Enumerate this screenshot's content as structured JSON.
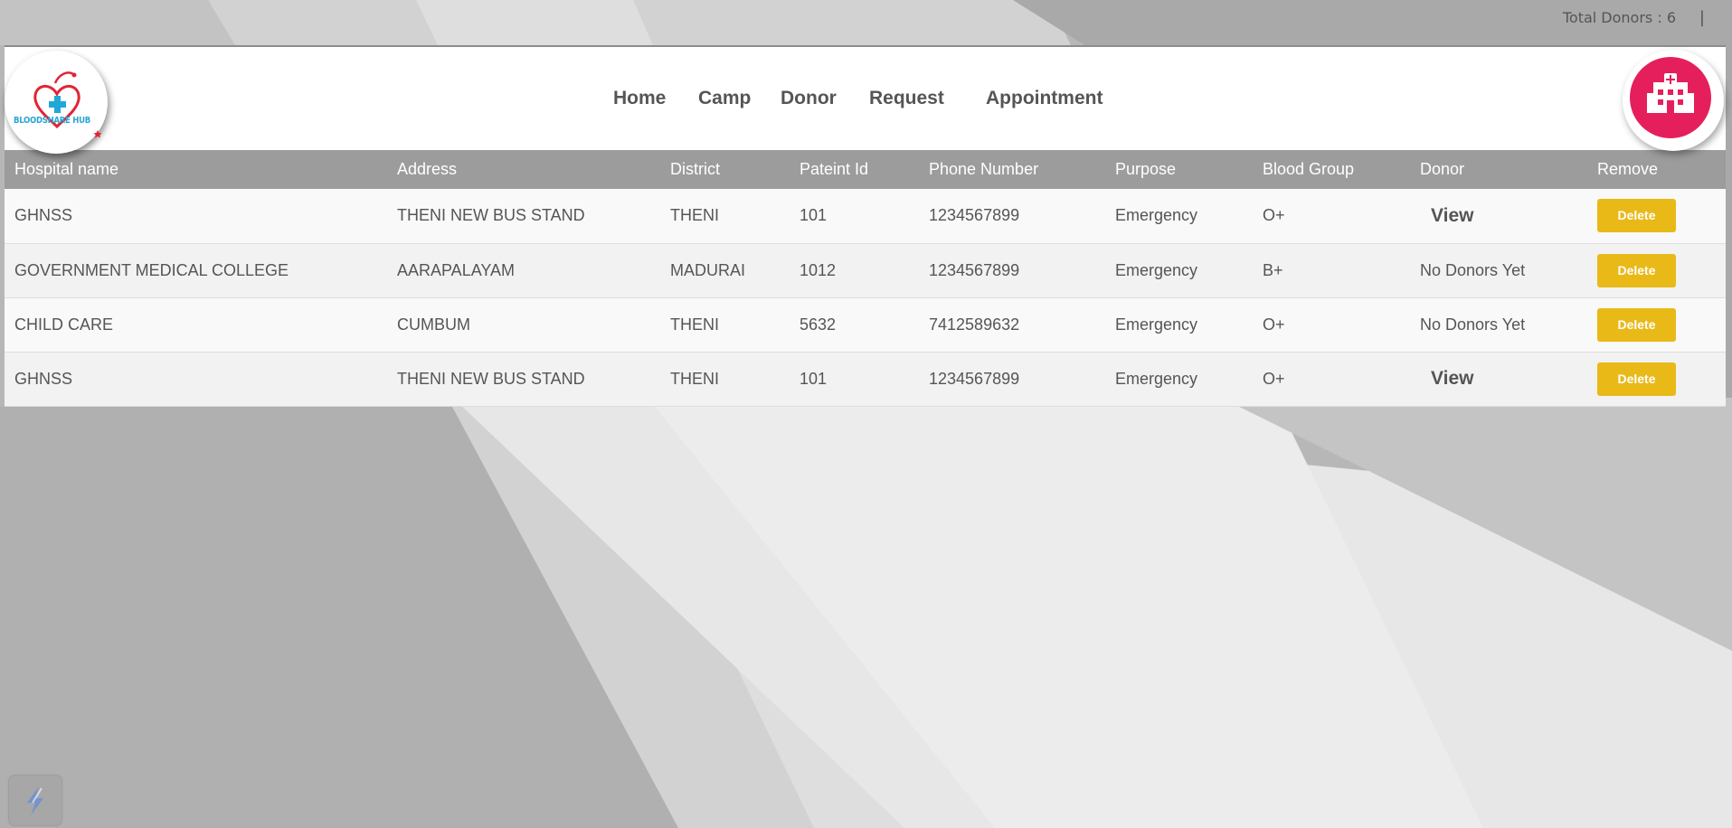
{
  "topbar": {
    "total_donors": "Total Donors : 6",
    "separator": "|"
  },
  "logo": {
    "text": "BLOODSHARE HUB",
    "icon": "heart-cross-logo-icon"
  },
  "nav": {
    "items": [
      {
        "label": "Home"
      },
      {
        "label": "Camp"
      },
      {
        "label": "Donor"
      },
      {
        "label": "Request"
      },
      {
        "label": "Appointment"
      }
    ]
  },
  "hospital_button": {
    "icon": "hospital-icon"
  },
  "table": {
    "headers": [
      "Hospital name",
      "Address",
      "District",
      "Pateint Id",
      "Phone Number",
      "Purpose",
      "Blood Group",
      "Donor",
      "Remove"
    ],
    "rows": [
      {
        "hospital": "GHNSS",
        "address": "THENI NEW BUS STAND",
        "district": "THENI",
        "patient_id": "101",
        "phone": "1234567899",
        "purpose": "Emergency",
        "blood_group": "O+",
        "donor": "View",
        "remove": "Delete"
      },
      {
        "hospital": "GOVERNMENT MEDICAL COLLEGE",
        "address": "AARAPALAYAM",
        "district": "MADURAI",
        "patient_id": "1012",
        "phone": "1234567899",
        "purpose": "Emergency",
        "blood_group": "B+",
        "donor": "No Donors Yet",
        "remove": "Delete"
      },
      {
        "hospital": "CHILD CARE",
        "address": "CUMBUM",
        "district": "THENI",
        "patient_id": "5632",
        "phone": "7412589632",
        "purpose": "Emergency",
        "blood_group": "O+",
        "donor": "No Donors Yet",
        "remove": "Delete"
      },
      {
        "hospital": "GHNSS",
        "address": "THENI NEW BUS STAND",
        "district": "THENI",
        "patient_id": "101",
        "phone": "1234567899",
        "purpose": "Emergency",
        "blood_group": "O+",
        "donor": "View",
        "remove": "Delete"
      }
    ]
  },
  "colors": {
    "header_row": "#9c9c9c",
    "delete_button": "#e9b918",
    "hospital_icon_bg": "#e51f5b",
    "logo_text": "#2aa6d6",
    "logo_heart": "#e02634"
  },
  "corner_widget": {
    "icon": "lightning-bolt-icon"
  }
}
